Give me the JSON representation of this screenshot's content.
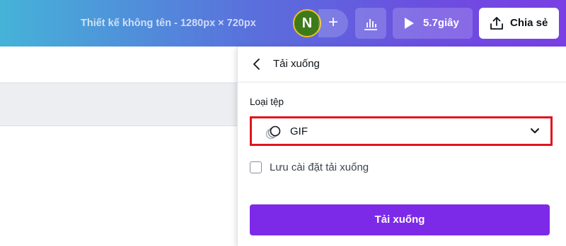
{
  "topbar": {
    "design_title": "Thiết kế không tên - 1280px × 720px",
    "avatar_initial": "N",
    "add_member_symbol": "+",
    "present_label": "5.7giây",
    "share_label": "Chia sẻ"
  },
  "download_panel": {
    "title": "Tải xuống",
    "file_type_label": "Loại tệp",
    "file_type_value": "GIF",
    "save_settings_label": "Lưu cài đặt tải xuống",
    "save_settings_checked": false,
    "download_button_label": "Tải xuống"
  },
  "colors": {
    "accent_purple": "#7d2ae8",
    "highlight_red": "#e0141e",
    "avatar_green": "#3e7a1a"
  },
  "icons": {
    "back": "chevron-left-icon",
    "analytics": "bar-chart-icon",
    "present": "play-icon",
    "share": "upload-icon",
    "file_format": "gif-format-icon",
    "dropdown": "chevron-down-icon"
  }
}
